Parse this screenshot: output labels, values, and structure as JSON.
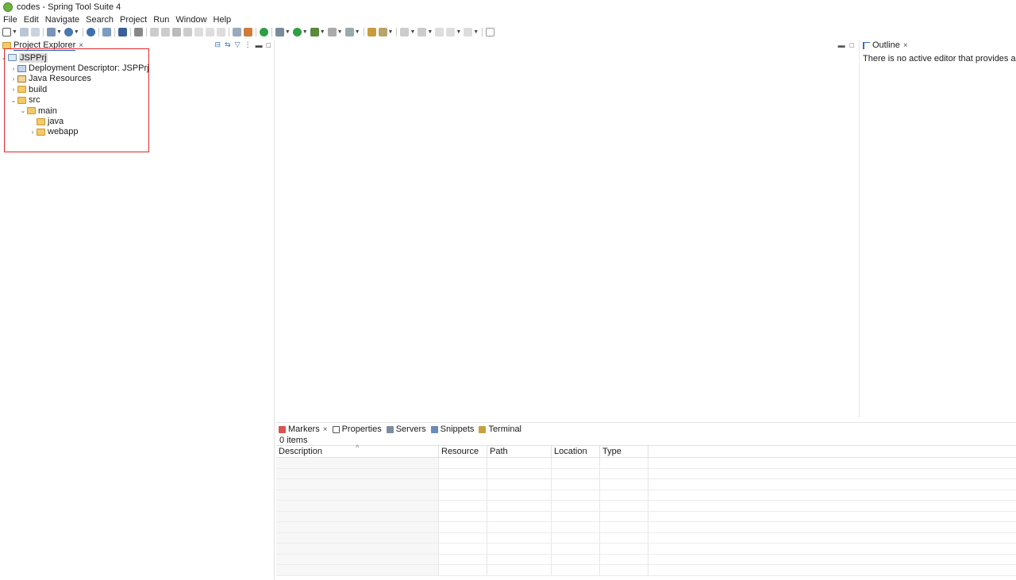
{
  "window": {
    "title": "codes - Spring Tool Suite 4"
  },
  "menu": [
    "File",
    "Edit",
    "Navigate",
    "Search",
    "Project",
    "Run",
    "Window",
    "Help"
  ],
  "colors": {
    "accent": "#2a5db0",
    "highlight_box": "#e0262b",
    "selection": "#dcdcdc"
  },
  "explorer": {
    "tab_label": "Project Explorer",
    "close_glyph": "×",
    "tree": [
      {
        "label": "JSPPrj",
        "expanded": true,
        "selected": true,
        "icon": "project-icon"
      },
      {
        "label": "Deployment Descriptor: JSPPrj",
        "expanded": false,
        "icon": "deployment-descriptor-icon"
      },
      {
        "label": "Java Resources",
        "expanded": false,
        "icon": "java-resources-icon"
      },
      {
        "label": "build",
        "expanded": false,
        "icon": "folder-icon"
      },
      {
        "label": "src",
        "expanded": true,
        "icon": "folder-icon"
      },
      {
        "label": "main",
        "expanded": true,
        "icon": "folder-icon"
      },
      {
        "label": "java",
        "expanded": null,
        "icon": "folder-icon"
      },
      {
        "label": "webapp",
        "expanded": false,
        "icon": "folder-icon"
      }
    ]
  },
  "outline": {
    "tab_label": "Outline",
    "close_glyph": "×",
    "message": "There is no active editor that provides an outline."
  },
  "bottom_panel": {
    "tabs": [
      {
        "label": "Markers",
        "active": true,
        "closable": true,
        "icon": "markers-icon"
      },
      {
        "label": "Properties",
        "active": false,
        "icon": "properties-icon"
      },
      {
        "label": "Servers",
        "active": false,
        "icon": "servers-icon"
      },
      {
        "label": "Snippets",
        "active": false,
        "icon": "snippets-icon"
      },
      {
        "label": "Terminal",
        "active": false,
        "icon": "terminal-icon"
      }
    ],
    "item_count": "0 items",
    "columns": [
      "Description",
      "Resource",
      "Path",
      "Location",
      "Type"
    ],
    "empty_rows": 11
  }
}
